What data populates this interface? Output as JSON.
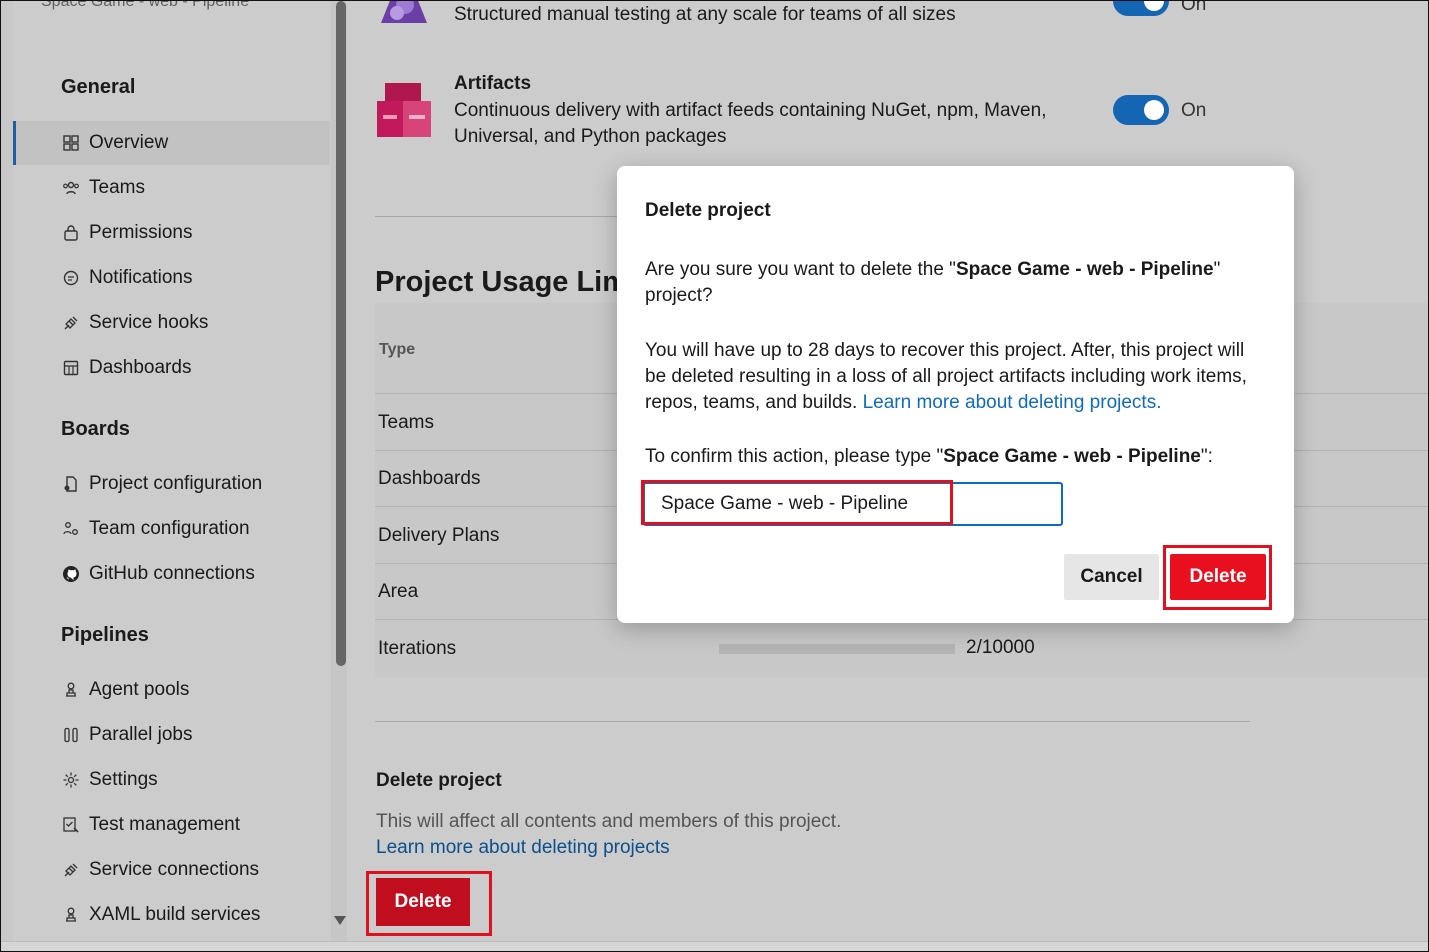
{
  "sidebar": {
    "project_name": "Space Game - web - Pipeline",
    "sections": {
      "general": {
        "heading": "General",
        "items": [
          "Overview",
          "Teams",
          "Permissions",
          "Notifications",
          "Service hooks",
          "Dashboards"
        ],
        "selected": "Overview"
      },
      "boards": {
        "heading": "Boards",
        "items": [
          "Project configuration",
          "Team configuration",
          "GitHub connections"
        ]
      },
      "pipelines": {
        "heading": "Pipelines",
        "items": [
          "Agent pools",
          "Parallel jobs",
          "Settings",
          "Test management",
          "Service connections",
          "XAML build services"
        ]
      }
    }
  },
  "services": {
    "test_plans": {
      "desc": "Structured manual testing at any scale for teams of all sizes",
      "state": "On"
    },
    "artifacts": {
      "title": "Artifacts",
      "desc": "Continuous delivery with artifact feeds containing NuGet, npm, Maven, Universal, and Python packages",
      "state": "On"
    }
  },
  "usage": {
    "title": "Project Usage Limits",
    "column_type": "Type",
    "rows": [
      "Teams",
      "Dashboards",
      "Delivery Plans",
      "Area",
      "Iterations"
    ],
    "iterations_value": "2/10000"
  },
  "delete_section": {
    "heading": "Delete project",
    "description": "This will affect all contents and members of this project.",
    "link": "Learn more about deleting projects",
    "button": "Delete"
  },
  "dialog": {
    "title": "Delete project",
    "confirm_prefix": "Are you sure you want to delete the \"",
    "project_name": "Space Game - web - Pipeline",
    "confirm_suffix": "\" project?",
    "recover_text": "You will have up to 28 days to recover this project. After, this project will be deleted resulting in a loss of all project artifacts including work items, repos, teams, and builds. ",
    "learn_more": "Learn more about deleting projects.",
    "type_prefix": "To confirm this action, please type \"",
    "type_suffix": "\":",
    "input_value": "Space Game - web - Pipeline",
    "cancel_label": "Cancel",
    "delete_label": "Delete"
  },
  "colors": {
    "accent": "#0f6cbd",
    "danger": "#e8101f",
    "highlight": "#e0101e"
  }
}
